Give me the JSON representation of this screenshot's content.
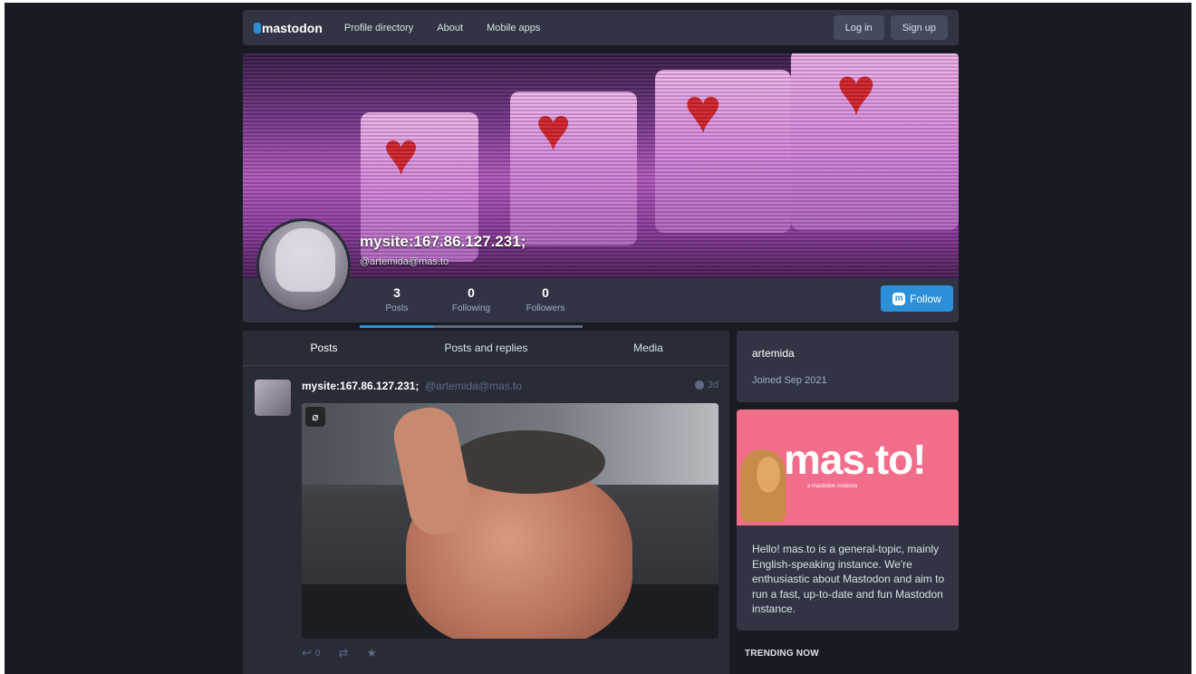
{
  "header": {
    "logo": "mastodon",
    "nav": [
      "Profile directory",
      "About",
      "Mobile apps"
    ],
    "login": "Log in",
    "signup": "Sign up"
  },
  "profile": {
    "display_name": "mysite:167.86.127.231;",
    "handle": "@artemida@mas.to",
    "stats": [
      {
        "value": "3",
        "label": "Posts"
      },
      {
        "value": "0",
        "label": "Following"
      },
      {
        "value": "0",
        "label": "Followers"
      }
    ],
    "follow_label": "Follow"
  },
  "timeline": {
    "tabs": [
      "Posts",
      "Posts and replies",
      "Media"
    ],
    "status": {
      "display_name": "mysite:167.86.127.231;",
      "handle": "@artemida@mas.to",
      "time": "3d",
      "reply_count": "0"
    }
  },
  "sidebar": {
    "account_name": "artemida",
    "joined": "Joined Sep 2021",
    "server_title": "mas.to!",
    "server_subtitle": "a mastodon instance",
    "server_description": "Hello! mas.to is a general-topic, mainly English-speaking instance. We're enthusiastic about Mastodon and aim to run a fast, up-to-date and fun Mastodon instance.",
    "trending_heading": "TRENDING NOW"
  },
  "colors": {
    "accent": "#2b90d9",
    "background": "#191b22",
    "panel": "#313543",
    "server_hero": "#f26d8a"
  }
}
